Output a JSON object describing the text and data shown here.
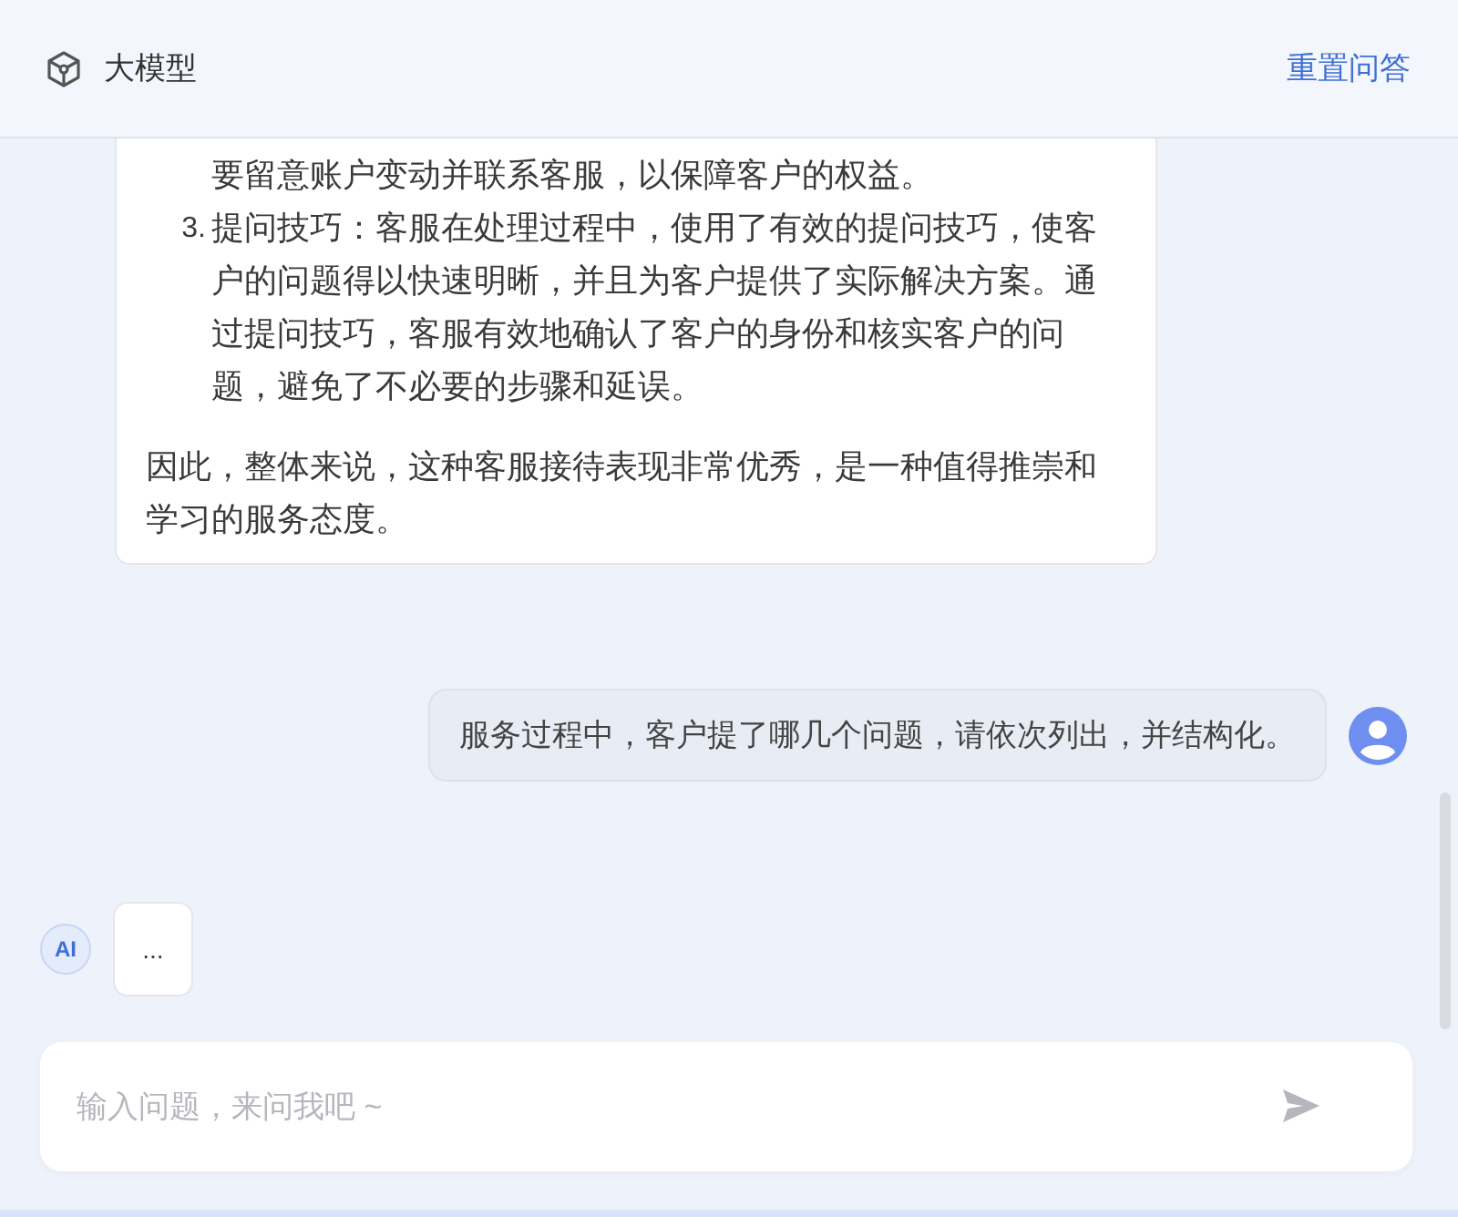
{
  "header": {
    "title": "大模型",
    "reset_link": "重置问答"
  },
  "messages": [
    {
      "kind": "answer",
      "continuation": "要留意账户变动并联系客服，以保障客户的权益。",
      "items": [
        {
          "number": "3.",
          "text": "提问技巧：客服在处理过程中，使用了有效的提问技巧，使客户的问题得以快速明晰，并且为客户提供了实际解决方案。通过提问技巧，客服有效地确认了客户的身份和核实客户的问题，避免了不必要的步骤和延误。"
        }
      ],
      "conclusion": "因此，整体来说，这种客服接待表现非常优秀，是一种值得推崇和学习的服务态度。"
    },
    {
      "kind": "question",
      "text": "服务过程中，客户提了哪几个问题，请依次列出，并结构化。"
    },
    {
      "kind": "pending",
      "avatar": "AI",
      "text": "..."
    }
  ],
  "input": {
    "placeholder": "输入问题，来问我吧 ~"
  }
}
